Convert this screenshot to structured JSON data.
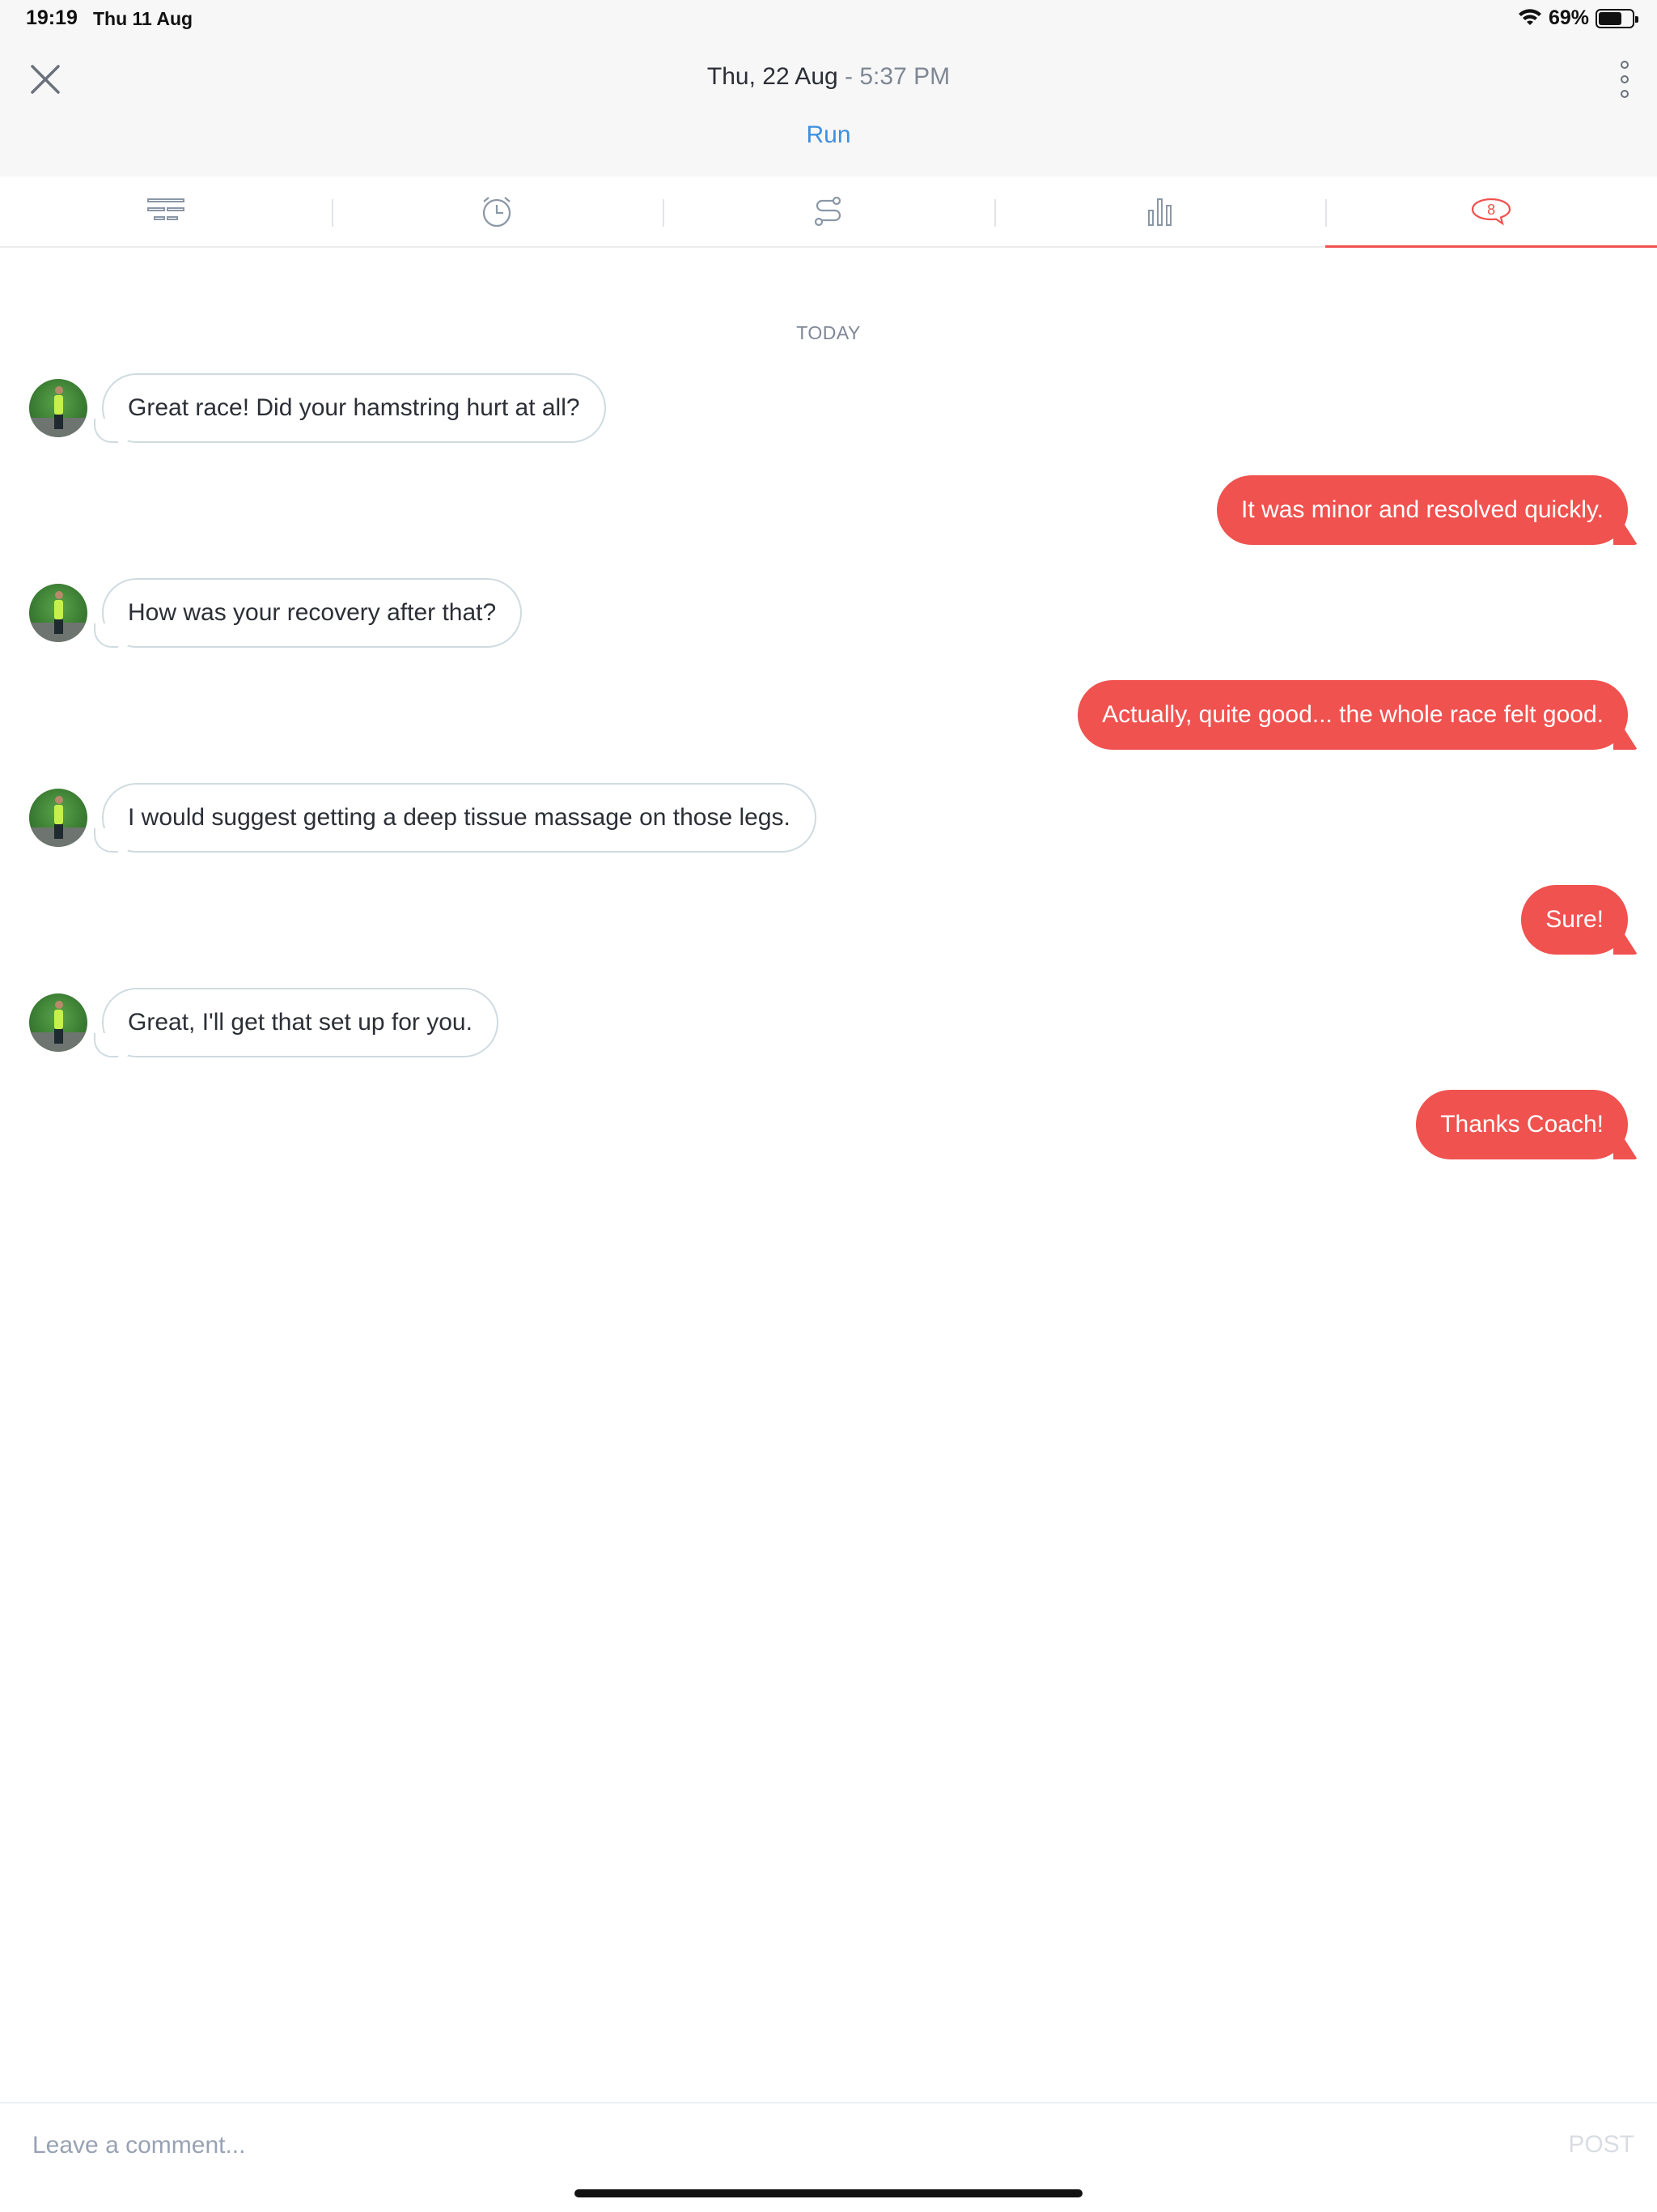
{
  "status_bar": {
    "time": "19:19",
    "date": "Thu 11 Aug",
    "battery": "69%",
    "battery_level": 0.69
  },
  "header": {
    "date": "Thu, 22 Aug",
    "separator": " - ",
    "time": "5:37 PM",
    "activity": "Run"
  },
  "tabs": [
    {
      "icon": "summary-icon",
      "active": false
    },
    {
      "icon": "clock-icon",
      "active": false
    },
    {
      "icon": "route-icon",
      "active": false
    },
    {
      "icon": "bar-chart-icon",
      "active": false
    },
    {
      "icon": "comments-icon",
      "badge": "8",
      "active": true
    }
  ],
  "chat": {
    "day_label": "TODAY",
    "messages": [
      {
        "from": "coach",
        "text": "Great race!  Did your hamstring hurt at all?"
      },
      {
        "from": "me",
        "text": "It was minor and resolved quickly."
      },
      {
        "from": "coach",
        "text": "How was your recovery after that?"
      },
      {
        "from": "me",
        "text": "Actually, quite good... the whole race felt good."
      },
      {
        "from": "coach",
        "text": "I would suggest getting a deep tissue massage on those legs."
      },
      {
        "from": "me",
        "text": "Sure!"
      },
      {
        "from": "coach",
        "text": "Great, I'll get that set up for you."
      },
      {
        "from": "me",
        "text": "Thanks Coach!"
      }
    ]
  },
  "composer": {
    "placeholder": "Leave a comment...",
    "value": "",
    "post_label": "POST"
  },
  "colors": {
    "accent": "#f0524f",
    "link": "#3d8fe0",
    "incoming_border": "#cfdbe0"
  }
}
